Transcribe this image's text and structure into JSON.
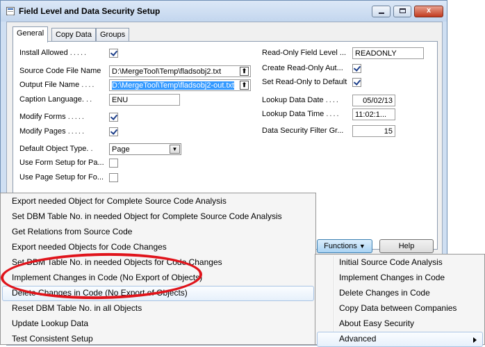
{
  "window": {
    "title": "Field Level and Data Security Setup",
    "controls": {
      "minimize": "minimize",
      "maximize": "maximize",
      "close": "x"
    }
  },
  "tabs": [
    {
      "label": "General",
      "active": true
    },
    {
      "label": "Copy Data",
      "active": false
    },
    {
      "label": "Groups",
      "active": false
    }
  ],
  "fields_left": {
    "install_allowed": {
      "label": "Install Allowed",
      "dots": ".....",
      "checked": true
    },
    "source_code_file_name": {
      "label": "Source Code File Name",
      "value": "D:\\MergeTool\\Temp\\fladsobj2.txt"
    },
    "output_file_name": {
      "label": "Output File Name",
      "dots": "....",
      "value": "D:\\MergeTool\\Temp\\fladsobj2-out.txt"
    },
    "caption_language": {
      "label": "Caption Language.",
      "dots": "..",
      "value": "ENU"
    },
    "modify_forms": {
      "label": "Modify Forms",
      "dots": ".....",
      "checked": true
    },
    "modify_pages": {
      "label": "Modify Pages",
      "dots": ".....",
      "checked": true
    },
    "default_object_type": {
      "label": "Default Object Type.",
      "dots": ".",
      "value": "Page"
    },
    "use_form_setup": {
      "label": "Use Form Setup for Pa...",
      "checked": false
    },
    "use_page_setup": {
      "label": "Use Page Setup for Fo...",
      "checked": false
    }
  },
  "fields_right": {
    "read_only_field_level": {
      "label": "Read-Only Field Level ...",
      "value": "READONLY"
    },
    "create_read_only_aut": {
      "label": "Create Read-Only Aut...",
      "checked": true
    },
    "set_read_only_default": {
      "label": "Set Read-Only to Default",
      "checked": true
    },
    "lookup_data_date": {
      "label": "Lookup Data Date",
      "dots": "....",
      "value": "05/02/13"
    },
    "lookup_data_time": {
      "label": "Lookup Data Time",
      "dots": "....",
      "value": "11:02:1..."
    },
    "data_security_filter": {
      "label": "Data Security Filter Gr...",
      "value": "15"
    }
  },
  "buttons": {
    "functions": "Functions",
    "help": "Help"
  },
  "functions_menu": [
    "Export needed Object for Complete Source Code Analysis",
    "Set DBM Table No. in needed Object for Complete Source Code Analysis",
    "Get Relations from Source Code",
    "Export needed Objects for Code Changes",
    "Set DBM Table No. in needed Objects for Code Changes",
    "Implement Changes in Code (No Export of Objects)",
    "Delete Changes in Code  (No Export of Objects)",
    "Reset DBM Table No. in all Objects",
    "Update Lookup Data",
    "Test Consistent Setup"
  ],
  "functions_menu_hover_index": 6,
  "submenu": [
    "Initial Source Code Analysis",
    "Implement Changes in Code",
    "Delete Changes in Code",
    "Copy Data between Companies",
    "About Easy Security",
    "Advanced"
  ],
  "submenu_hover_index": 5,
  "colors": {
    "highlight_circle": "#e0141b",
    "selection": "#3399ff",
    "titlebar": "#c3d6ee"
  }
}
